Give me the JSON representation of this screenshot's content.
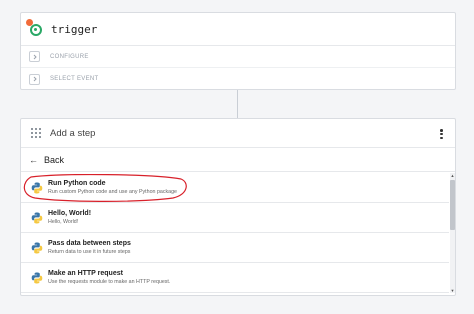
{
  "trigger": {
    "title": "trigger",
    "steps": [
      {
        "label": "CONFIGURE"
      },
      {
        "label": "SELECT EVENT"
      }
    ]
  },
  "add_step": {
    "title": "Add a step",
    "back_label": "Back",
    "items": [
      {
        "title": "Run Python code",
        "description": "Run custom Python code and use any Python package"
      },
      {
        "title": "Hello, World!",
        "description": "Hello, World!"
      },
      {
        "title": "Pass data between steps",
        "description": "Return data to use it in future steps"
      },
      {
        "title": "Make an HTTP request",
        "description": "Use the requests module to make an HTTP request."
      }
    ]
  },
  "colors": {
    "trigger_green": "#2aa866",
    "notification_dot": "#f26b3a",
    "highlight_annotation": "#d8202a"
  },
  "icons": {
    "trigger": "trigger-ring-icon",
    "step_chevron": "chevron-right-icon",
    "drag_handle": "grid-dots-icon",
    "menu": "kebab-menu-icon",
    "back": "arrow-left-icon",
    "python": "python-icon"
  }
}
